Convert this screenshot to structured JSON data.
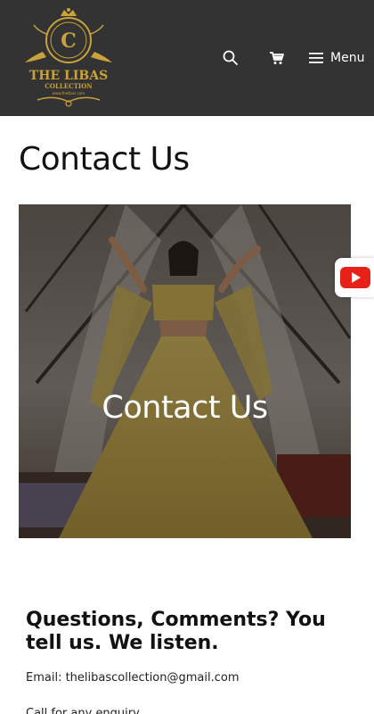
{
  "header": {
    "logo": {
      "monogram": "C",
      "brand_line_1": "THE LIBAS",
      "brand_line_2": "COLLECTION",
      "site": "www.thelibas.com"
    },
    "search_icon": "search-icon",
    "cart_icon": "cart-icon",
    "menu_icon": "hamburger-icon",
    "menu_label": "Menu"
  },
  "main": {
    "page_title": "Contact Us",
    "hero": {
      "overlay_title": "Contact Us"
    },
    "questions_heading": "Questions, Comments? You tell us. We listen.",
    "email_line": "Email: thelibascollection@gmail.com",
    "cut_off_line": "Call for any enquiry"
  },
  "floating": {
    "youtube_icon": "youtube-icon"
  },
  "colors": {
    "header_bg": "#333333",
    "logo_gold": "#c9a23a",
    "youtube_red": "#e62117"
  }
}
